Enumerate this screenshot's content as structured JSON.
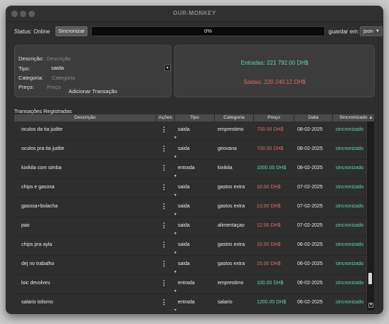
{
  "window": {
    "title": "OUR-MONKEY"
  },
  "statusbar": {
    "status_text": "Status: Online",
    "sync_button": "Sincronizar",
    "progress": "0%",
    "save_label": "guardar em:",
    "format_selected": "json"
  },
  "form": {
    "descricao_label": "Descrição:",
    "descricao_placeholder": "Descrição",
    "tipo_label": "Tipo:",
    "tipo_value": "saida",
    "categoria_label": "Categoria:",
    "categoria_placeholder": "Categoria",
    "preco_label": "Preço:",
    "preco_placeholder": "Preço",
    "add_button": "Adicionar Transação"
  },
  "summary": {
    "entradas": "Entradas: 221 792.00 DH$",
    "saidas": "Saidas: 220 240.12 DH$"
  },
  "table": {
    "title": "Transações Registradas",
    "headers": [
      "Descrição",
      "Ações",
      "Tipo",
      "Categoria",
      "Preço",
      "Data",
      "Sincronizado"
    ],
    "rows": [
      {
        "descricao": "oculos da tia judite",
        "acoes": "⋮",
        "tipo": "saida",
        "categoria": "emprestimo",
        "preco": "700.00 DH$",
        "data": "08-02-2025",
        "sync": "sincronizado"
      },
      {
        "descricao": "oculos pra tia judite",
        "acoes": "⋮",
        "tipo": "saida",
        "categoria": "geovana",
        "preco": "700.00 DH$",
        "data": "08-02-2025",
        "sync": "sincronizado"
      },
      {
        "descricao": "kixikila com simba",
        "acoes": "⋮",
        "tipo": "entrada",
        "categoria": "kixikila",
        "preco": "1000.00 DH$",
        "data": "08-02-2025",
        "sync": "sincronizado"
      },
      {
        "descricao": "chips e gasosa",
        "acoes": "⋮",
        "tipo": "saida",
        "categoria": "gastos extra",
        "preco": "10.00 DH$",
        "data": "07-02-2025",
        "sync": "sincronizado"
      },
      {
        "descricao": "gasosa+bolacha",
        "acoes": "⋮",
        "tipo": "saida",
        "categoria": "gastos extra",
        "preco": "13.00 DH$",
        "data": "07-02-2025",
        "sync": "sincronizado"
      },
      {
        "descricao": "pao",
        "acoes": "⋮",
        "tipo": "saida",
        "categoria": "alimentaçao",
        "preco": "12.00 DH$",
        "data": "07-02-2025",
        "sync": "sincronizado"
      },
      {
        "descricao": "chips pra ayla",
        "acoes": "⋮",
        "tipo": "saida",
        "categoria": "gastos extra",
        "preco": "10.00 DH$",
        "data": "06-02-2025",
        "sync": "sincronizado"
      },
      {
        "descricao": "dej no trabalho",
        "acoes": "⋮",
        "tipo": "saida",
        "categoria": "gastos extra",
        "preco": "15.00 DH$",
        "data": "06-02-2025",
        "sync": "sincronizado"
      },
      {
        "descricao": "loic devolveu",
        "acoes": "⋮",
        "tipo": "entrada",
        "categoria": "emprestimo",
        "preco": "100.00 DH$",
        "data": "06-02-2025",
        "sync": "sincronizado"
      },
      {
        "descricao": "salario tolismo",
        "acoes": "⋮",
        "tipo": "entrada",
        "categoria": "salario",
        "preco": "1200.00 DH$",
        "data": "06-02-2025",
        "sync": "sincronizado"
      }
    ]
  },
  "colors": {
    "positive": "#5fd9a6",
    "negative": "#e06a6a"
  }
}
